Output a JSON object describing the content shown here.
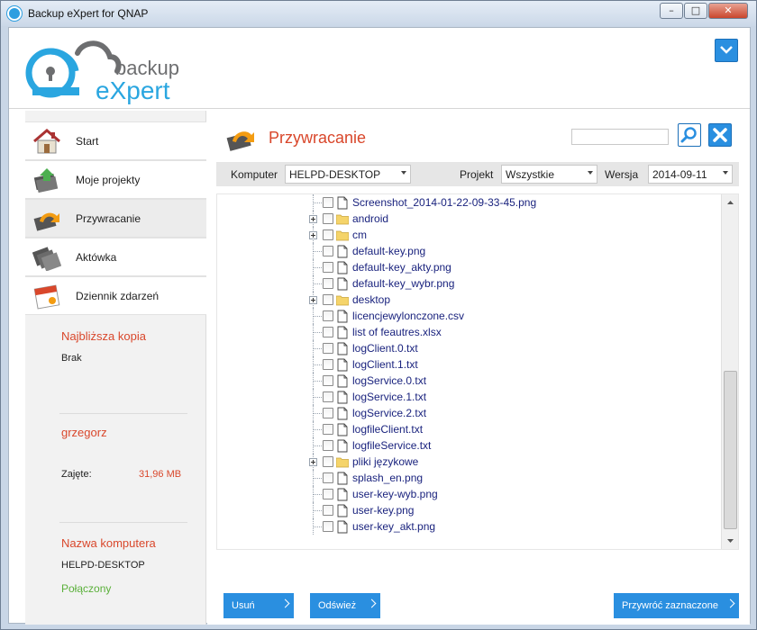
{
  "window": {
    "title": "Backup eXpert for QNAP",
    "minimize_glyph": "–",
    "maximize_glyph": "□",
    "close_glyph": "✕"
  },
  "logo": {
    "line1": "backup",
    "line2": "eXpert"
  },
  "sidebar": {
    "items": [
      {
        "label": "Start",
        "icon": "home-icon"
      },
      {
        "label": "Moje projekty",
        "icon": "projects-icon"
      },
      {
        "label": "Przywracanie",
        "icon": "restore-icon",
        "active": true
      },
      {
        "label": "Aktówka",
        "icon": "briefcase-icon"
      },
      {
        "label": "Dziennik zdarzeń",
        "icon": "calendar-icon"
      }
    ],
    "next_backup_title": "Najbliższa kopia",
    "next_backup_value": "Brak",
    "user_name": "grzegorz",
    "used_label": "Zajęte:",
    "used_value": "31,96 MB",
    "computer_title": "Nazwa komputera",
    "computer_value": "HELPD-DESKTOP",
    "connection_status": "Połączony"
  },
  "main": {
    "title": "Przywracanie",
    "search": {
      "value": "",
      "placeholder": ""
    },
    "filters": {
      "computer_label": "Komputer",
      "computer_value": "HELPD-DESKTOP",
      "project_label": "Projekt",
      "project_value": "Wszystkie",
      "version_label": "Wersja",
      "version_value": "2014-09-11"
    },
    "tree": [
      {
        "name": "Screenshot_2014-01-22-09-33-45.png",
        "type": "file",
        "expandable": false
      },
      {
        "name": "android",
        "type": "folder",
        "expandable": true
      },
      {
        "name": "cm",
        "type": "folder",
        "expandable": true
      },
      {
        "name": "default-key.png",
        "type": "file",
        "expandable": false
      },
      {
        "name": "default-key_akty.png",
        "type": "file",
        "expandable": false
      },
      {
        "name": "default-key_wybr.png",
        "type": "file",
        "expandable": false
      },
      {
        "name": "desktop",
        "type": "folder",
        "expandable": true
      },
      {
        "name": "licencjewylonczone.csv",
        "type": "file",
        "expandable": false
      },
      {
        "name": "list of feautres.xlsx",
        "type": "file",
        "expandable": false
      },
      {
        "name": "logClient.0.txt",
        "type": "file",
        "expandable": false
      },
      {
        "name": "logClient.1.txt",
        "type": "file",
        "expandable": false
      },
      {
        "name": "logService.0.txt",
        "type": "file",
        "expandable": false
      },
      {
        "name": "logService.1.txt",
        "type": "file",
        "expandable": false
      },
      {
        "name": "logService.2.txt",
        "type": "file",
        "expandable": false
      },
      {
        "name": "logfileClient.txt",
        "type": "file",
        "expandable": false
      },
      {
        "name": "logfileService.txt",
        "type": "file",
        "expandable": false
      },
      {
        "name": "pliki językowe",
        "type": "folder",
        "expandable": true
      },
      {
        "name": "splash_en.png",
        "type": "file",
        "expandable": false
      },
      {
        "name": "user-key-wyb.png",
        "type": "file",
        "expandable": false
      },
      {
        "name": "user-key.png",
        "type": "file",
        "expandable": false
      },
      {
        "name": "user-key_akt.png",
        "type": "file",
        "expandable": false
      }
    ],
    "buttons": {
      "delete": "Usuń",
      "refresh": "Odśwież",
      "restore_selected": "Przywróć zaznaczone"
    }
  },
  "colors": {
    "accent": "#2a8fe0",
    "title_red": "#d9472b",
    "status_green": "#5ab03a",
    "file_name": "#1a237e",
    "folder": "#f5d46a"
  }
}
